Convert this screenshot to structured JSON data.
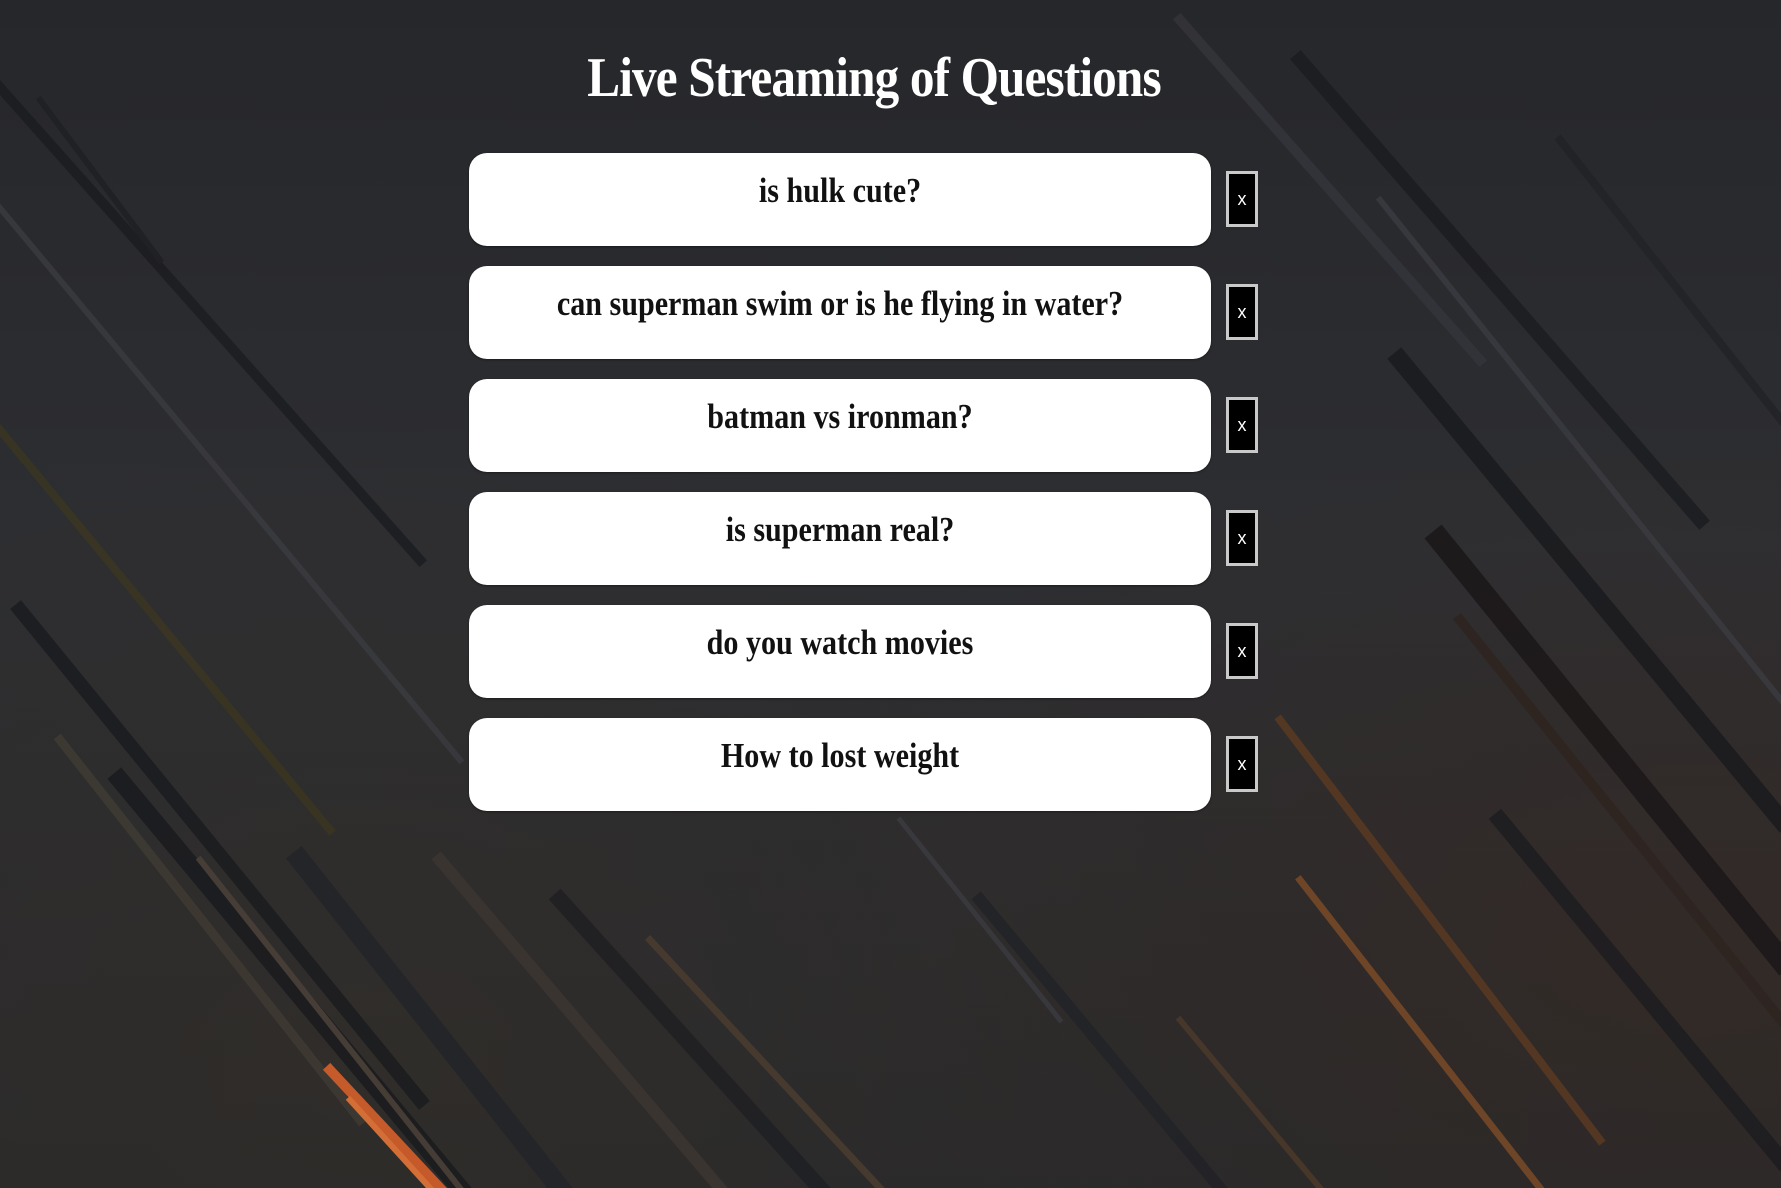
{
  "page": {
    "title": "Live Streaming of Questions"
  },
  "questions": [
    {
      "text": "is hulk cute?",
      "delete_label": "x"
    },
    {
      "text": "can superman swim or is he flying in water?",
      "delete_label": "x"
    },
    {
      "text": "batman vs ironman?",
      "delete_label": "x"
    },
    {
      "text": "is superman real?",
      "delete_label": "x"
    },
    {
      "text": "do you watch movies",
      "delete_label": "x"
    },
    {
      "text": "How to lost weight",
      "delete_label": "x"
    }
  ],
  "colors": {
    "background": "#2a2b2f",
    "card": "#ffffff",
    "delete_button": "#000000",
    "accent_streaks": "#e0622a"
  }
}
